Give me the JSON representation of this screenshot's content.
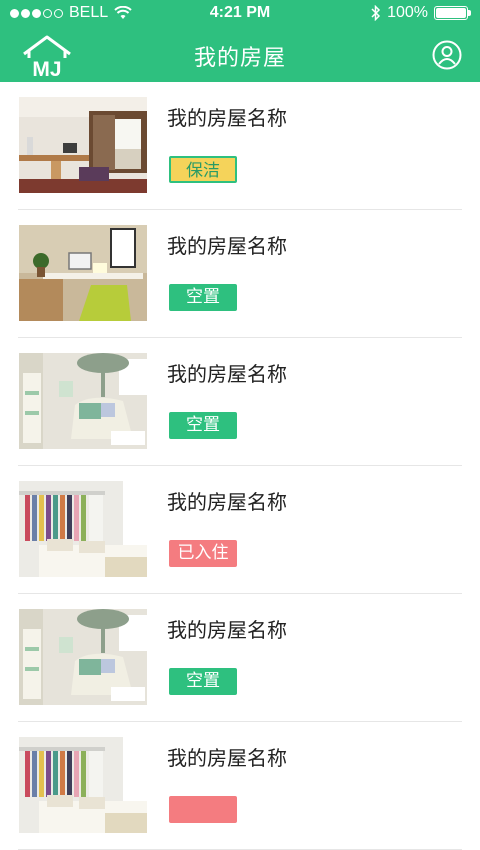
{
  "status_bar": {
    "carrier": "BELL",
    "time": "4:21 PM",
    "battery_percent": "100%",
    "battery_level": 1.0
  },
  "header": {
    "title": "我的房屋",
    "logo_text": "MJ",
    "accent_color": "#2ec07f"
  },
  "houses": [
    {
      "name": "我的房屋名称",
      "status": "保洁",
      "status_type": "clean",
      "image": "study-room"
    },
    {
      "name": "我的房屋名称",
      "status": "空置",
      "status_type": "vacant",
      "image": "office-desk"
    },
    {
      "name": "我的房屋名称",
      "status": "空置",
      "status_type": "vacant",
      "image": "living-room-tree"
    },
    {
      "name": "我的房屋名称",
      "status": "已入住",
      "status_type": "occupied",
      "image": "bedroom-wardrobe"
    },
    {
      "name": "我的房屋名称",
      "status": "空置",
      "status_type": "vacant",
      "image": "living-room-tree"
    },
    {
      "name": "我的房屋名称",
      "status": "",
      "status_type": "occupied",
      "image": "bedroom-wardrobe"
    }
  ],
  "status_colors": {
    "clean": "#f5d35a",
    "vacant": "#2ec07f",
    "occupied": "#f47c80"
  }
}
